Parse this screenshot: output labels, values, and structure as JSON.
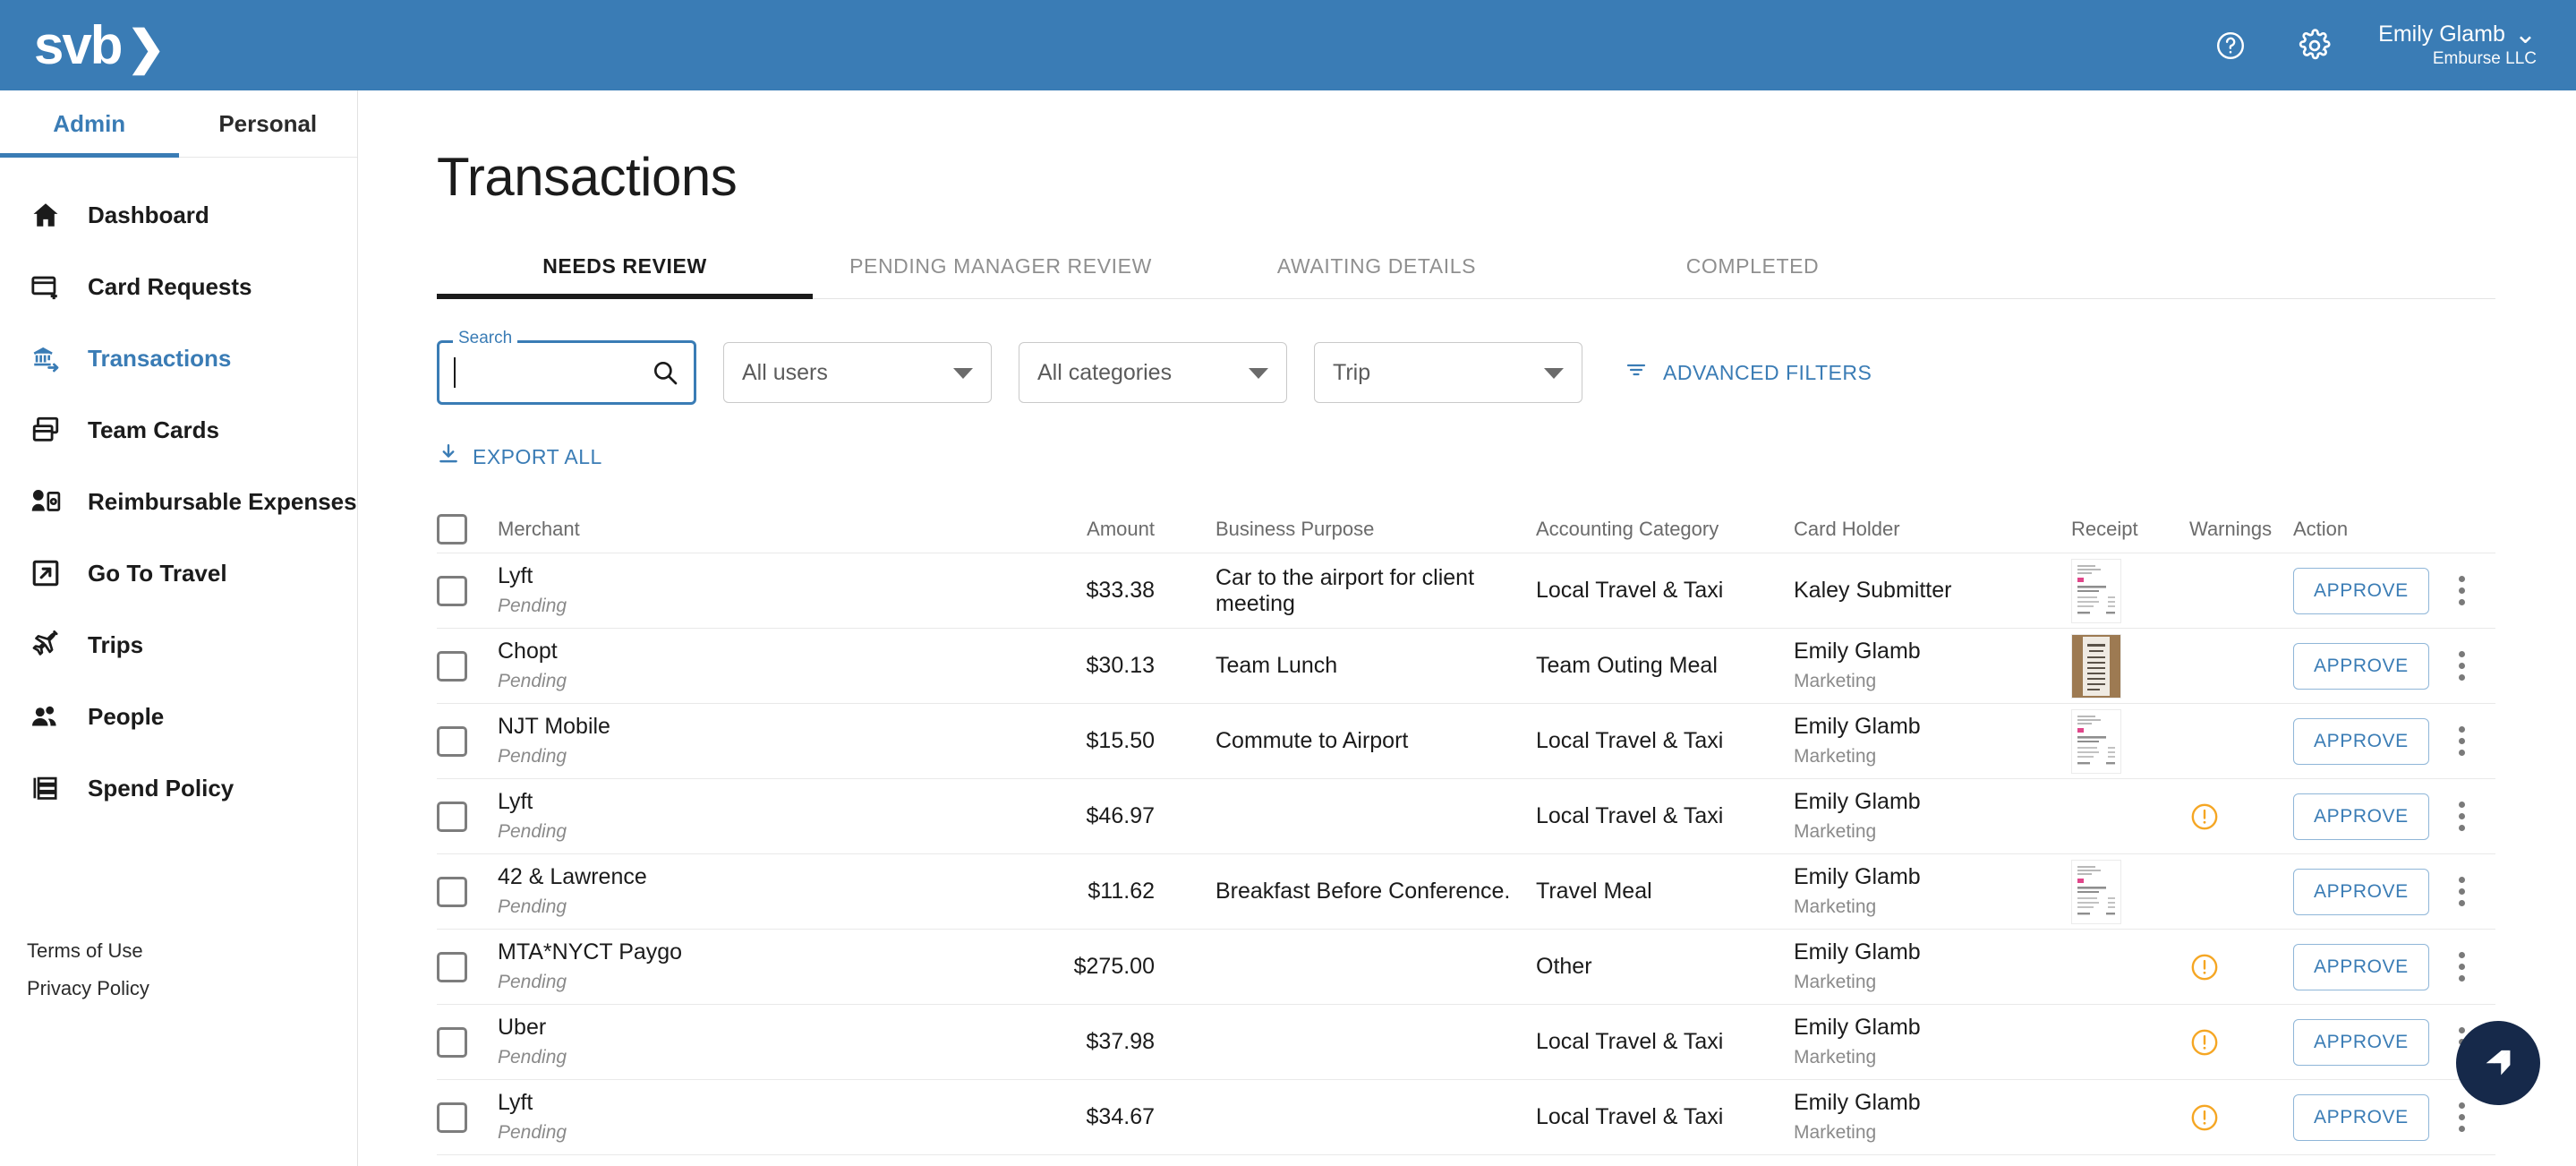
{
  "brand": {
    "logo_text": "svb",
    "logo_chevron": "❯",
    "accent": "#3a7cb5",
    "fab_color": "#16294a",
    "warning_color": "#f5a623"
  },
  "topbar": {
    "help_icon": "help-circle-icon",
    "settings_icon": "gear-icon",
    "user_name": "Emily Glamb",
    "user_org": "Emburse LLC",
    "chevron": "⌄"
  },
  "sidebar": {
    "segments": [
      {
        "label": "Admin",
        "active": true
      },
      {
        "label": "Personal",
        "active": false
      }
    ],
    "items": [
      {
        "label": "Dashboard",
        "icon": "home-icon",
        "active": false
      },
      {
        "label": "Card Requests",
        "icon": "card-plus-icon",
        "active": false
      },
      {
        "label": "Transactions",
        "icon": "bank-transfer-icon",
        "active": true
      },
      {
        "label": "Team Cards",
        "icon": "cards-stack-icon",
        "active": false
      },
      {
        "label": "Reimbursable Expenses",
        "icon": "person-money-icon",
        "active": false
      },
      {
        "label": "Go To Travel",
        "icon": "external-link-icon",
        "active": false
      },
      {
        "label": "Trips",
        "icon": "airplane-icon",
        "active": false
      },
      {
        "label": "People",
        "icon": "people-icon",
        "active": false
      },
      {
        "label": "Spend Policy",
        "icon": "policy-list-icon",
        "active": false
      }
    ],
    "legal": [
      {
        "label": "Terms of Use"
      },
      {
        "label": "Privacy Policy"
      }
    ]
  },
  "main": {
    "title": "Transactions",
    "tabs": [
      {
        "label": "NEEDS REVIEW",
        "active": true
      },
      {
        "label": "PENDING MANAGER REVIEW",
        "active": false
      },
      {
        "label": "AWAITING DETAILS",
        "active": false
      },
      {
        "label": "COMPLETED",
        "active": false
      }
    ],
    "filters": {
      "search_label": "Search",
      "search_value": "",
      "search_placeholder": "",
      "search_icon": "magnifier-icon",
      "users_select": "All users",
      "categories_select": "All categories",
      "trip_select": "Trip",
      "advanced_filters_label": "ADVANCED FILTERS",
      "advanced_filters_icon": "filter-icon",
      "export_all_label": "EXPORT ALL",
      "export_all_icon": "download-icon"
    },
    "table": {
      "columns": [
        "Merchant",
        "Amount",
        "Business Purpose",
        "Accounting Category",
        "Card Holder",
        "Receipt",
        "Warnings",
        "Action"
      ],
      "approve_label": "APPROVE",
      "rows": [
        {
          "merchant": "Lyft",
          "status": "Pending",
          "amount": "$33.38",
          "purpose": "Car to the airport for client meeting",
          "category": "Local Travel & Taxi",
          "holder": "Kaley Submitter",
          "holder_dept": "",
          "receipt": "document",
          "warning": false
        },
        {
          "merchant": "Chopt",
          "status": "Pending",
          "amount": "$30.13",
          "purpose": "Team Lunch",
          "category": "Team Outing Meal",
          "holder": "Emily Glamb",
          "holder_dept": "Marketing",
          "receipt": "photo",
          "warning": false
        },
        {
          "merchant": "NJT Mobile",
          "status": "Pending",
          "amount": "$15.50",
          "purpose": "Commute to Airport",
          "category": "Local Travel & Taxi",
          "holder": "Emily Glamb",
          "holder_dept": "Marketing",
          "receipt": "document",
          "warning": false
        },
        {
          "merchant": "Lyft",
          "status": "Pending",
          "amount": "$46.97",
          "purpose": "",
          "category": "Local Travel & Taxi",
          "holder": "Emily Glamb",
          "holder_dept": "Marketing",
          "receipt": "",
          "warning": true
        },
        {
          "merchant": "42 & Lawrence",
          "status": "Pending",
          "amount": "$11.62",
          "purpose": "Breakfast Before Conference.",
          "category": "Travel Meal",
          "holder": "Emily Glamb",
          "holder_dept": "Marketing",
          "receipt": "document",
          "warning": false
        },
        {
          "merchant": "MTA*NYCT Paygo",
          "status": "Pending",
          "amount": "$275.00",
          "purpose": "",
          "category": "Other",
          "holder": "Emily Glamb",
          "holder_dept": "Marketing",
          "receipt": "",
          "warning": true
        },
        {
          "merchant": "Uber",
          "status": "Pending",
          "amount": "$37.98",
          "purpose": "",
          "category": "Local Travel & Taxi",
          "holder": "Emily Glamb",
          "holder_dept": "Marketing",
          "receipt": "",
          "warning": true
        },
        {
          "merchant": "Lyft",
          "status": "Pending",
          "amount": "$34.67",
          "purpose": "",
          "category": "Local Travel & Taxi",
          "holder": "Emily Glamb",
          "holder_dept": "Marketing",
          "receipt": "",
          "warning": true
        }
      ]
    },
    "fab_icon": "chat-bubble-icon"
  }
}
